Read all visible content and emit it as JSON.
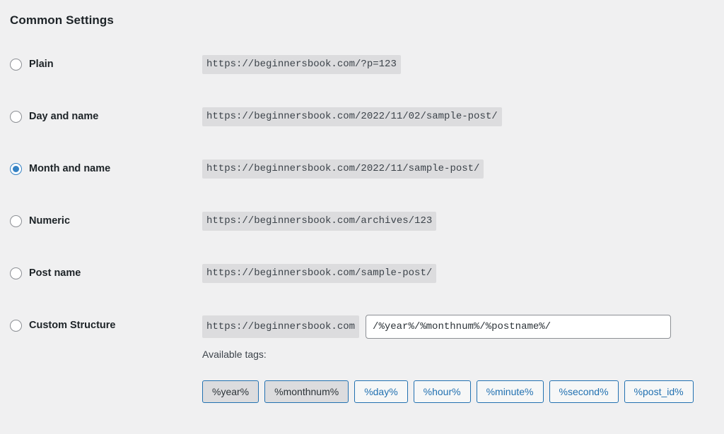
{
  "section": {
    "title": "Common Settings"
  },
  "options": [
    {
      "id": "plain",
      "label": "Plain",
      "selected": false,
      "example": "https://beginnersbook.com/?p=123"
    },
    {
      "id": "day-and-name",
      "label": "Day and name",
      "selected": false,
      "example": "https://beginnersbook.com/2022/11/02/sample-post/"
    },
    {
      "id": "month-and-name",
      "label": "Month and name",
      "selected": true,
      "example": "https://beginnersbook.com/2022/11/sample-post/"
    },
    {
      "id": "numeric",
      "label": "Numeric",
      "selected": false,
      "example": "https://beginnersbook.com/archives/123"
    },
    {
      "id": "post-name",
      "label": "Post name",
      "selected": false,
      "example": "https://beginnersbook.com/sample-post/"
    }
  ],
  "custom_structure": {
    "label": "Custom Structure",
    "selected": false,
    "site_prefix": "https://beginnersbook.com",
    "value": "/%year%/%monthnum%/%postname%/",
    "available_tags_label": "Available tags:"
  },
  "tags": [
    {
      "label": "%year%",
      "used": true
    },
    {
      "label": "%monthnum%",
      "used": true
    },
    {
      "label": "%day%",
      "used": false
    },
    {
      "label": "%hour%",
      "used": false
    },
    {
      "label": "%minute%",
      "used": false
    },
    {
      "label": "%second%",
      "used": false
    },
    {
      "label": "%post_id%",
      "used": false
    }
  ],
  "colors": {
    "page_background": "#f0f0f1",
    "code_background": "#dcdcde",
    "accent_blue": "#2271b1",
    "radio_selected": "#3582c4",
    "heading_text": "#1d2327",
    "body_text": "#3c434a",
    "input_border": "#8c8f94"
  }
}
